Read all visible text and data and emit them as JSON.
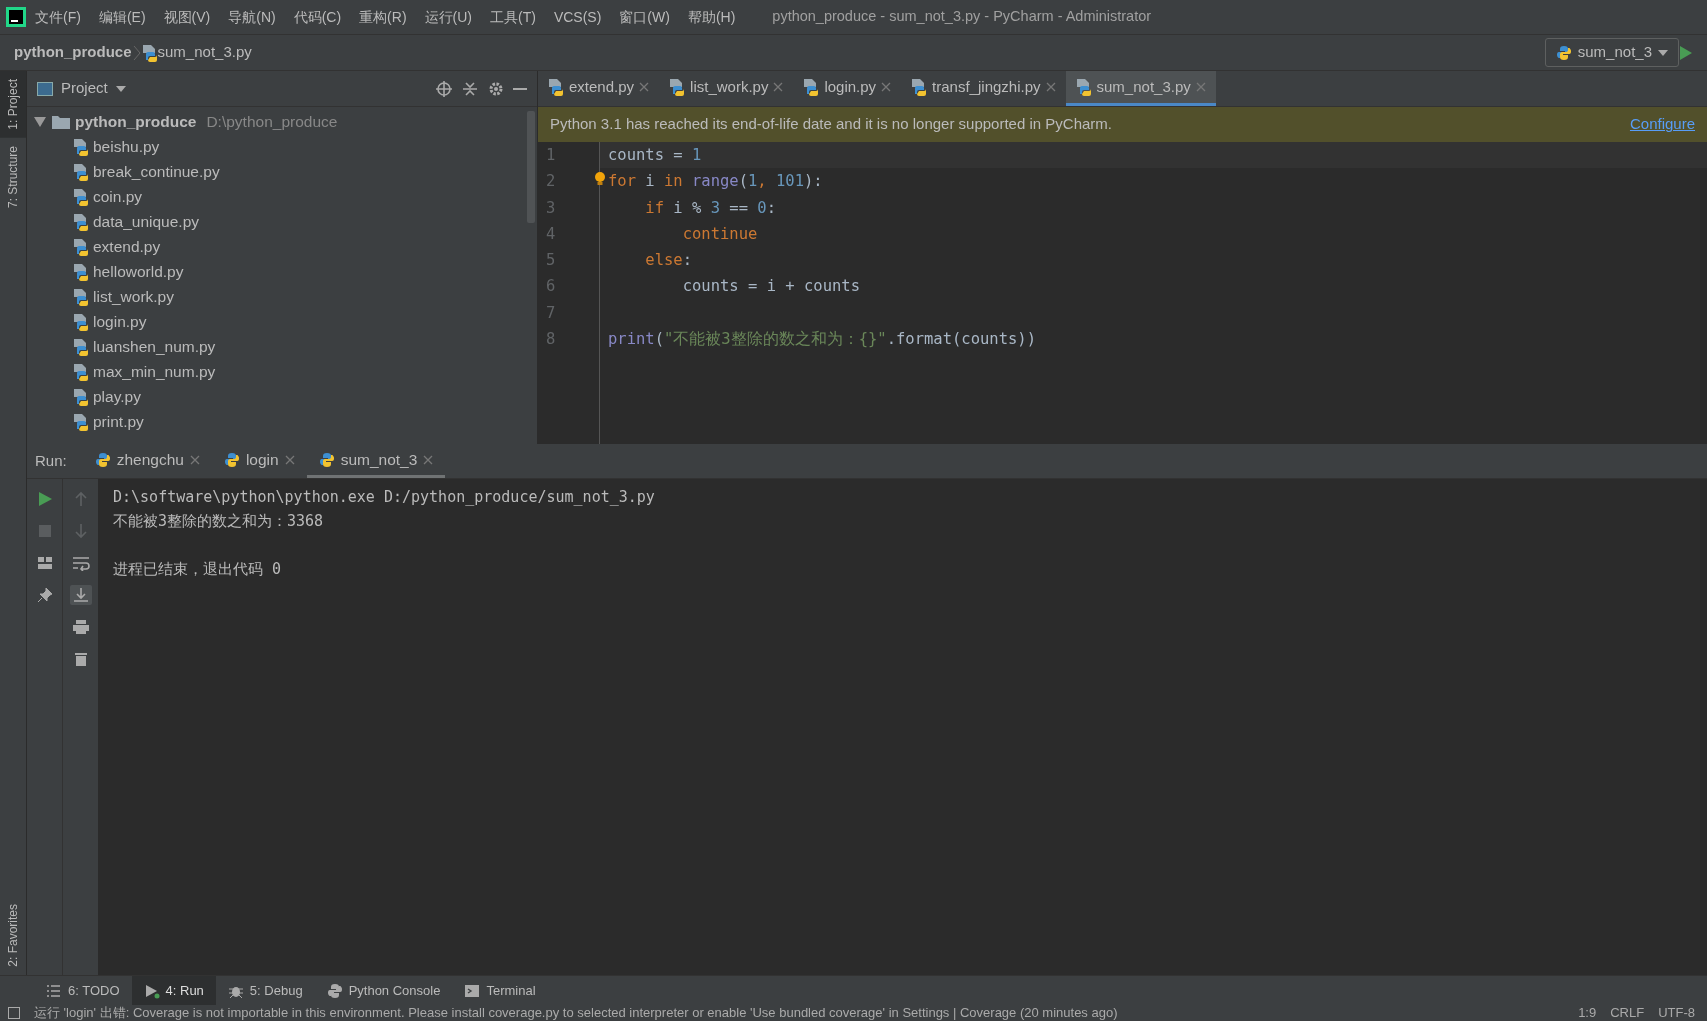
{
  "menu": {
    "items": [
      "文件(F)",
      "编辑(E)",
      "视图(V)",
      "导航(N)",
      "代码(C)",
      "重构(R)",
      "运行(U)",
      "工具(T)",
      "VCS(S)",
      "窗口(W)",
      "帮助(H)"
    ],
    "title": "python_produce - sum_not_3.py - PyCharm - Administrator"
  },
  "breadcrumb": [
    "python_produce",
    "sum_not_3.py"
  ],
  "run_config": {
    "label": "sum_not_3"
  },
  "left_stripe": [
    {
      "label": "1: Project",
      "selected": true
    },
    {
      "label": "7: Structure",
      "selected": false
    }
  ],
  "favorites": {
    "label": "2: Favorites"
  },
  "project": {
    "title": "Project",
    "root": {
      "name": "python_produce",
      "path": "D:\\python_produce",
      "expanded": true,
      "children": [
        {
          "name": "beishu.py"
        },
        {
          "name": "break_continue.py"
        },
        {
          "name": "coin.py"
        },
        {
          "name": "data_unique.py"
        },
        {
          "name": "extend.py"
        },
        {
          "name": "helloworld.py"
        },
        {
          "name": "list_work.py"
        },
        {
          "name": "login.py"
        },
        {
          "name": "luanshen_num.py"
        },
        {
          "name": "max_min_num.py"
        },
        {
          "name": "play.py"
        },
        {
          "name": "print.py"
        }
      ]
    }
  },
  "editor_tabs": [
    {
      "label": "extend.py",
      "selected": false
    },
    {
      "label": "list_work.py",
      "selected": false
    },
    {
      "label": "login.py",
      "selected": false
    },
    {
      "label": "transf_jingzhi.py",
      "selected": false
    },
    {
      "label": "sum_not_3.py",
      "selected": true
    }
  ],
  "banner": {
    "message": "Python 3.1 has reached its end-of-life date and it is no longer supported in PyCharm.",
    "action": "Configure"
  },
  "code": [
    {
      "number": "1",
      "tokens": [
        {
          "text": "counts = ",
          "kind": "plain"
        },
        {
          "text": "1",
          "kind": "number"
        }
      ]
    },
    {
      "number": "2",
      "tokens": [
        {
          "text": "for",
          "kind": "keyword"
        },
        {
          "text": " i ",
          "kind": "plain"
        },
        {
          "text": "in",
          "kind": "keyword"
        },
        {
          "text": " range",
          "kind": "builtin"
        },
        {
          "text": "(",
          "kind": "plain"
        },
        {
          "text": "1",
          "kind": "number"
        },
        {
          "text": ",",
          "kind": "keyword"
        },
        {
          "text": " 101",
          "kind": "number"
        },
        {
          "text": "):",
          "kind": "plain"
        }
      ]
    },
    {
      "number": "3",
      "tokens": [
        {
          "text": "    if",
          "kind": "keyword"
        },
        {
          "text": " i % ",
          "kind": "plain"
        },
        {
          "text": "3",
          "kind": "number"
        },
        {
          "text": " == ",
          "kind": "plain"
        },
        {
          "text": "0",
          "kind": "number"
        },
        {
          "text": ":",
          "kind": "plain"
        }
      ]
    },
    {
      "number": "4",
      "tokens": [
        {
          "text": "        continue",
          "kind": "keyword"
        }
      ]
    },
    {
      "number": "5",
      "tokens": [
        {
          "text": "    else",
          "kind": "keyword"
        },
        {
          "text": ":",
          "kind": "plain"
        }
      ]
    },
    {
      "number": "6",
      "tokens": [
        {
          "text": "        counts = i + counts",
          "kind": "plain"
        }
      ]
    },
    {
      "number": "7"
    },
    {
      "number": "8",
      "tokens": [
        {
          "text": "print",
          "kind": "builtin"
        },
        {
          "text": "(",
          "kind": "plain"
        },
        {
          "text": "\"不能被3整除的数之和为：{}\"",
          "kind": "string"
        },
        {
          "text": ".format(counts))",
          "kind": "plain"
        }
      ]
    }
  ],
  "run": {
    "label": "Run:",
    "tabs": [
      {
        "label": "zhengchu",
        "selected": false
      },
      {
        "label": "login",
        "selected": false
      },
      {
        "label": "sum_not_3",
        "selected": true
      }
    ],
    "output_blocks": [
      [
        "D:\\software\\python\\python.exe D:/python_produce/sum_not_3.py",
        "不能被3整除的数之和为：3368"
      ],
      [
        "进程已结束，退出代码 0"
      ]
    ]
  },
  "bottom_tabs": [
    {
      "label": "6: TODO",
      "selected": false,
      "kind": "list"
    },
    {
      "label": "4: Run",
      "selected": true,
      "kind": "run"
    },
    {
      "label": "5: Debug",
      "selected": false,
      "kind": "bug"
    },
    {
      "label": "Python Console",
      "selected": false,
      "kind": "python"
    },
    {
      "label": "Terminal",
      "selected": false,
      "kind": "terminal"
    }
  ],
  "status": {
    "message": "运行 'login' 出错: Coverage is not importable in this environment. Please install coverage.py to selected interpreter or enable 'Use bundled coverage' in Settings | Coverage (20 minutes ago)",
    "position": "1:9",
    "line_separator": "CRLF",
    "encoding": "UTF-8"
  }
}
